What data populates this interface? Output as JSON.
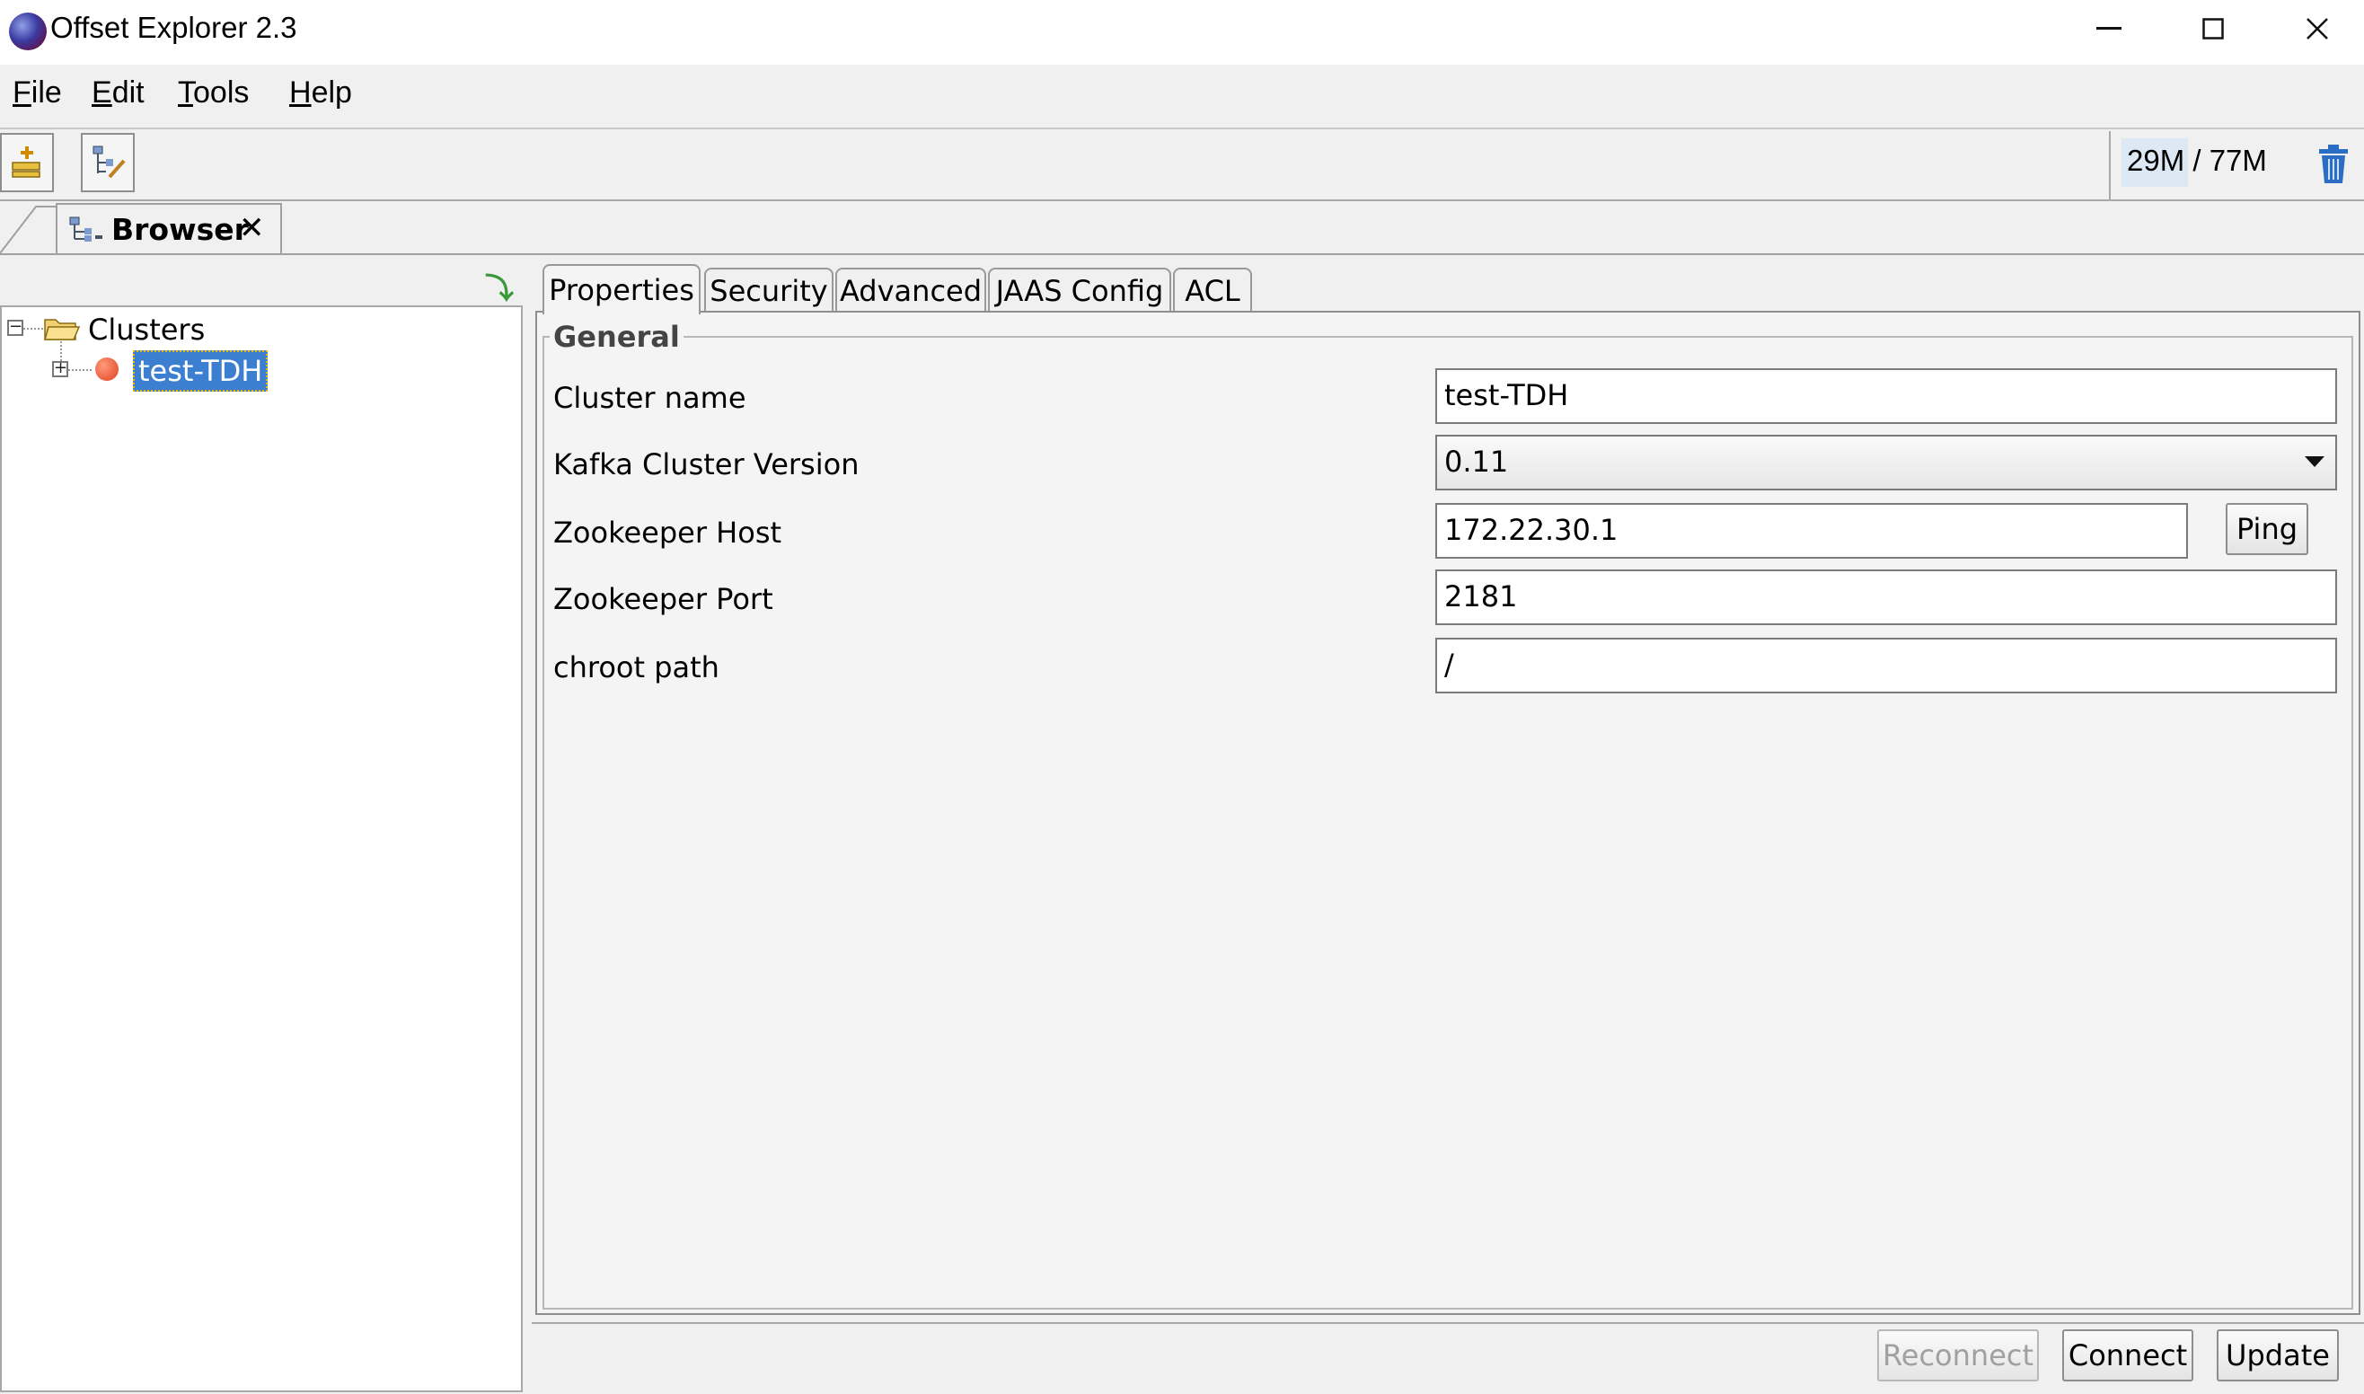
{
  "window": {
    "title": "Offset Explorer  2.3",
    "minimize": "—",
    "maximize": "☐",
    "close": "✕"
  },
  "menu": {
    "file": {
      "mnemonic": "F",
      "rest": "ile"
    },
    "edit": {
      "mnemonic": "E",
      "rest": "dit"
    },
    "tools": {
      "mnemonic": "T",
      "rest": "ools"
    },
    "help": {
      "mnemonic": "H",
      "rest": "elp"
    }
  },
  "toolbar": {
    "memory": "29M / 77M",
    "icons": [
      "add-cluster-icon",
      "edit-cluster-icon",
      "trash-icon"
    ]
  },
  "tabs": {
    "browser_label": "Browser",
    "browser_close": "✕"
  },
  "tree": {
    "root_label": "Clusters",
    "cluster_label": "test-TDH",
    "cluster_status_color": "#e04020"
  },
  "panel_tabs": [
    "Properties",
    "Security",
    "Advanced",
    "JAAS Config",
    "ACL"
  ],
  "general": {
    "title": "General",
    "cluster_name_label": "Cluster name",
    "cluster_name_value": "test-TDH",
    "kafka_version_label": "Kafka Cluster Version",
    "kafka_version_value": "0.11",
    "zk_host_label": "Zookeeper Host",
    "zk_host_value": "172.22.30.1",
    "ping_label": "Ping",
    "zk_port_label": "Zookeeper Port",
    "zk_port_value": "2181",
    "chroot_label": "chroot path",
    "chroot_value": "/"
  },
  "actions": {
    "reconnect": "Reconnect",
    "connect": "Connect",
    "update": "Update"
  }
}
